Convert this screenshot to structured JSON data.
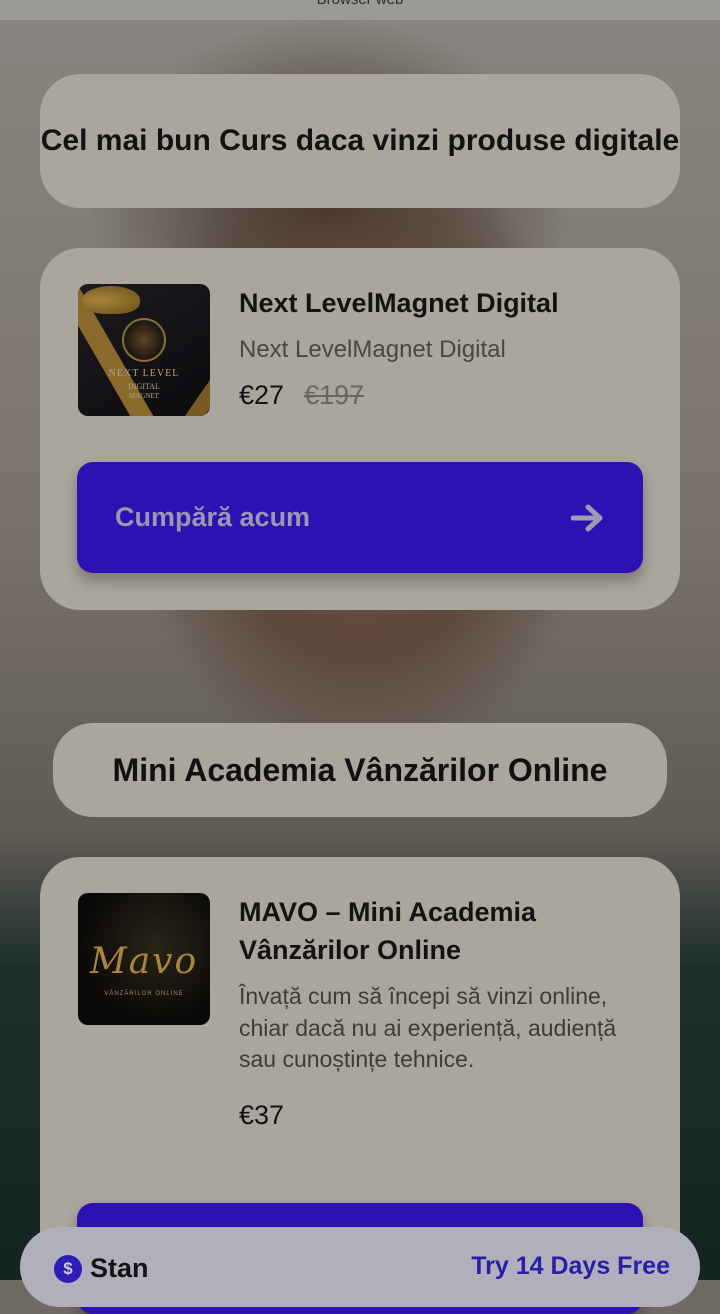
{
  "browser": {
    "title": "Browser web"
  },
  "header": {
    "title": "Cel mai bun Curs daca vinzi produse digitale"
  },
  "products": [
    {
      "title": "Next LevelMagnet Digital",
      "subtitle": "Next LevelMagnet Digital",
      "price": "€27",
      "old_price": "€197",
      "button_label": "Cumpără acum",
      "thumb_lines": [
        "NEXT LEVEL",
        "DIGITAL",
        "MAGNET"
      ]
    },
    {
      "title": "MAVO – Mini Academia Vânzărilor Online",
      "description": "Învață cum să începi să vinzi online, chiar dacă nu ai experiență, audiență sau cunoștințe tehnice.",
      "price": "€37",
      "thumb_script": "Mavo",
      "thumb_sub": "VÂNZĂRILOR ONLINE"
    }
  ],
  "section": {
    "title": "Mini Academia Vânzărilor Online"
  },
  "footer": {
    "brand": "Stan",
    "brand_icon": "$",
    "cta": "Try 14 Days Free"
  },
  "colors": {
    "accent": "#2c12b3",
    "card": "#aaa59d",
    "footer": "#b2afbc"
  },
  "icons": {
    "arrow": "arrow-right-icon",
    "brand": "stan-dollar-icon"
  }
}
